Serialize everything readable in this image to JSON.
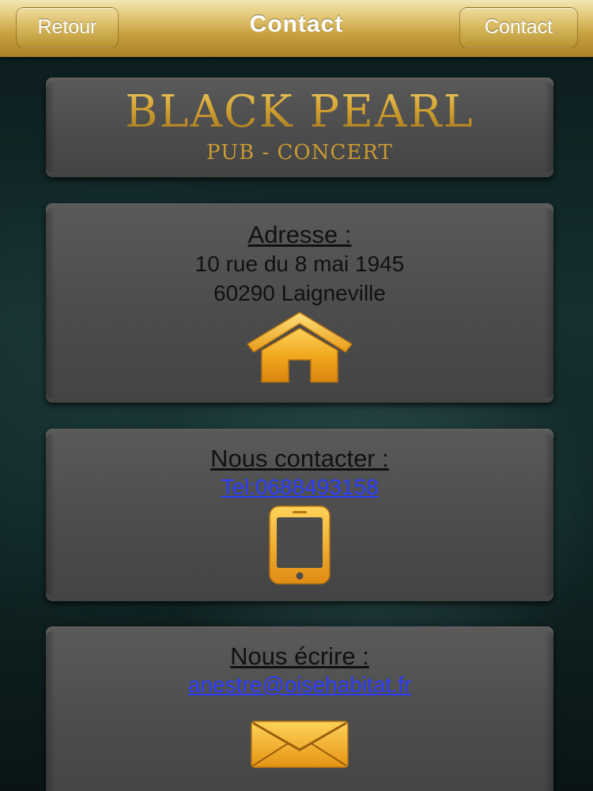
{
  "navbar": {
    "back_label": "Retour",
    "title": "Contact",
    "contact_label": "Contact"
  },
  "logo": {
    "title": "BLACK PEARL",
    "subtitle": "PUB - CONCERT"
  },
  "address": {
    "heading": "Adresse :",
    "line1": "10 rue du 8 mai 1945",
    "line2": "60290 Laigneville",
    "icon": "home-icon"
  },
  "phone": {
    "heading": "Nous contacter :",
    "link": "Tel:0688493158",
    "icon": "smartphone-icon"
  },
  "email": {
    "heading": "Nous écrire :",
    "link": "anestre@oisehabitat.fr",
    "icon": "envelope-icon"
  },
  "colors": {
    "gold": "#d9ae3c",
    "link": "#2a3bff",
    "card": "#4c4c4c"
  }
}
